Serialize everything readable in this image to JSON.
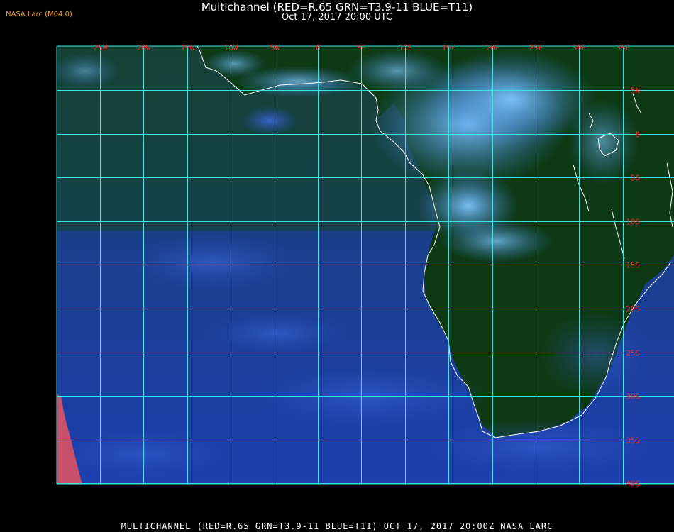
{
  "logo": "NASA Larc (M04.0)",
  "title": "Multichannel (RED=R.65 GRN=T3.9-11 BLUE=T11)",
  "subtitle": "Oct 17, 2017 20:00 UTC",
  "footer": "MULTICHANNEL (RED=R.65 GRN=T3.9-11 BLUE=T11) OCT 17, 2017 20:00Z   NASA LARC",
  "lon_labels": [
    "25W",
    "20W",
    "15W",
    "10W",
    "5W",
    "0",
    "5E",
    "10E",
    "15E",
    "20E",
    "25E",
    "30E",
    "35E"
  ],
  "lat_labels": [
    "5N",
    "0",
    "5S",
    "10S",
    "15S",
    "20S",
    "25S",
    "30S",
    "35S",
    "40S"
  ],
  "colors": {
    "grid": "#40e0e0",
    "label": "#e03030",
    "coast": "#ffffff",
    "ocean": "#1a3fa0",
    "land": "#0e3a12"
  }
}
